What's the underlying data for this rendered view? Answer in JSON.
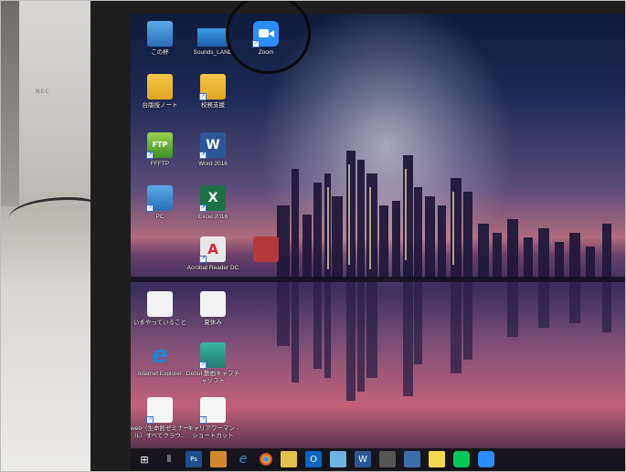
{
  "desktop": {
    "icons": [
      {
        "label": "この杯",
        "icon": "pc-icon"
      },
      {
        "label": "Sounds_LAND",
        "icon": "network-folder-icon"
      },
      {
        "label": "Zoom",
        "icon": "zoom-icon"
      },
      {
        "label": "台版授ノート",
        "icon": "folder-icon"
      },
      {
        "label": "校務支援",
        "icon": "folder-icon"
      },
      {
        "label": "FFFTP",
        "icon": "ffftp-icon"
      },
      {
        "label": "Word 2016",
        "icon": "word-icon"
      },
      {
        "label": "PC",
        "icon": "pc-monitor-icon"
      },
      {
        "label": "Excel 2016",
        "icon": "excel-icon"
      },
      {
        "label": "Acrobat Reader DC",
        "icon": "acrobat-icon"
      },
      {
        "label": "いまやっていること",
        "icon": "document-icon"
      },
      {
        "label": "夏休み",
        "icon": "document-icon"
      },
      {
        "label": "Internet Explorer",
        "icon": "internet-explorer-icon"
      },
      {
        "label": "Debut 動画キャプチャソフト",
        "icon": "debut-icon"
      },
      {
        "label": "web（生命館ゼミナール）すべてクラウ...",
        "icon": "web-document-icon"
      },
      {
        "label": "キャリアワーマン - ショートカット",
        "icon": "document-icon"
      }
    ]
  },
  "taskbar": {
    "start_glyph": "⊞",
    "taskview_glyph": "⫴",
    "ps_label": "Ps",
    "edge_glyph": "e",
    "word_label": "W",
    "outlook_label": "O"
  },
  "annotation": {
    "target": "Zoom"
  }
}
